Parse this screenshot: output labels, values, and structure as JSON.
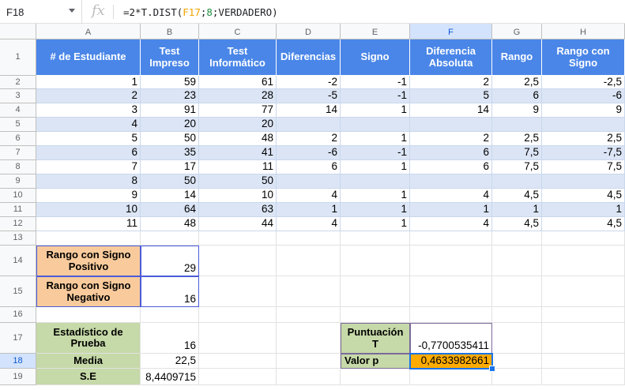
{
  "formula_bar": {
    "cell_ref": "F18",
    "fx": "fx",
    "formula_prefix": "=2*T.DIST(",
    "formula_ref": "F17",
    "formula_sep": ";",
    "formula_num": "8",
    "formula_suffix": ";VERDADERO)"
  },
  "columns": [
    "A",
    "B",
    "C",
    "D",
    "E",
    "F",
    "G",
    "H"
  ],
  "rows": [
    "1",
    "2",
    "3",
    "4",
    "5",
    "6",
    "7",
    "8",
    "9",
    "10",
    "11",
    "12",
    "13",
    "14",
    "15",
    "16",
    "17",
    "18",
    "19"
  ],
  "headers": [
    "# de Estudiante",
    "Test Impreso",
    "Test Informático",
    "Diferencias",
    "Signo",
    "Diferencia Absoluta",
    "Rango",
    "Rango con Signo"
  ],
  "data": [
    [
      "1",
      "59",
      "61",
      "-2",
      "-1",
      "2",
      "2,5",
      "-2,5"
    ],
    [
      "2",
      "23",
      "28",
      "-5",
      "-1",
      "5",
      "6",
      "-6"
    ],
    [
      "3",
      "91",
      "77",
      "14",
      "1",
      "14",
      "9",
      "9"
    ],
    [
      "4",
      "20",
      "20",
      "",
      "",
      "",
      "",
      ""
    ],
    [
      "5",
      "50",
      "48",
      "2",
      "1",
      "2",
      "2,5",
      "2,5"
    ],
    [
      "6",
      "35",
      "41",
      "-6",
      "-1",
      "6",
      "7,5",
      "-7,5"
    ],
    [
      "7",
      "17",
      "11",
      "6",
      "1",
      "6",
      "7,5",
      "7,5"
    ],
    [
      "8",
      "50",
      "50",
      "",
      "",
      "",
      "",
      ""
    ],
    [
      "9",
      "14",
      "10",
      "4",
      "1",
      "4",
      "4,5",
      "4,5"
    ],
    [
      "10",
      "64",
      "63",
      "1",
      "1",
      "1",
      "1",
      "1"
    ],
    [
      "11",
      "48",
      "44",
      "4",
      "1",
      "4",
      "4,5",
      "4,5"
    ]
  ],
  "summary": {
    "pos_label": "Rango con Signo Positivo",
    "pos_value": "29",
    "neg_label": "Rango con Signo Negativo",
    "neg_value": "16",
    "stat_label": "Estadístico de Prueba",
    "stat_value": "16",
    "mean_label": "Media",
    "mean_value": "22,5",
    "se_label": "S.E",
    "se_value": "8,4409715"
  },
  "results": {
    "score_label": "Puntuación T",
    "score_value": "-0,7700535411",
    "p_label": "Valor p",
    "p_value": "0,4633982661"
  },
  "colors": {
    "header_blue": "#4a86e8",
    "band_blue": "#dbe5f5",
    "orange": "#f9cb9c",
    "green": "#c6d9a8",
    "highlight": "#ffab00",
    "selection": "#1a73e8"
  }
}
